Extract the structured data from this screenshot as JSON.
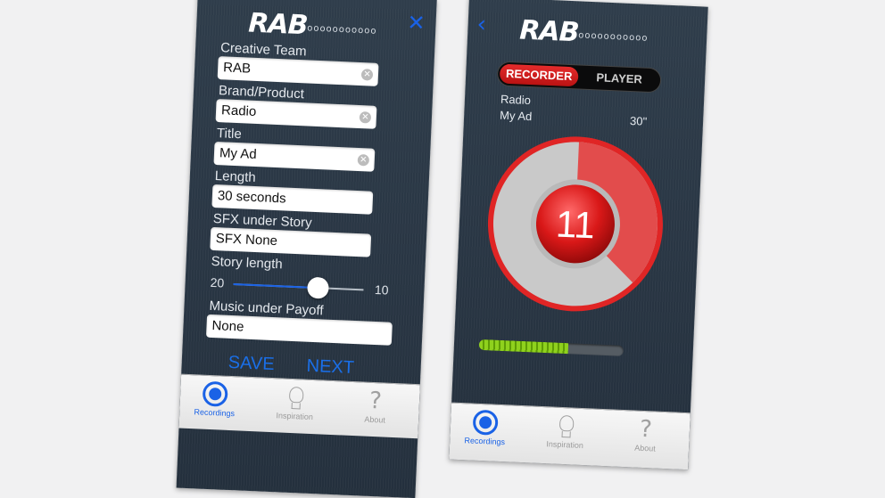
{
  "form_screen": {
    "logo": "RAB",
    "logo_dots": "ooooooooooo",
    "close_glyph": "✕",
    "fields": [
      {
        "label": "Creative Team",
        "value": "RAB",
        "clearable": true
      },
      {
        "label": "Brand/Product",
        "value": "Radio",
        "clearable": true
      },
      {
        "label": "Title",
        "value": "My Ad",
        "clearable": true
      },
      {
        "label": "Length",
        "value": "30 seconds",
        "clearable": false
      },
      {
        "label": "SFX under Story",
        "value": "SFX None",
        "clearable": false
      }
    ],
    "story_length": {
      "label": "Story length",
      "min_label": "20",
      "max_label": "10",
      "level": 0.65
    },
    "music": {
      "label": "Music under Payoff",
      "value": "None"
    },
    "save_label": "SAVE",
    "next_label": "NEXT"
  },
  "recorder_screen": {
    "logo": "RAB",
    "logo_dots": "ooooooooooo",
    "back_glyph": "‹",
    "segment": {
      "recorder": "RECORDER",
      "player": "PLAYER",
      "selected": "RECORDER"
    },
    "brand": "Radio",
    "title": "My Ad",
    "duration": "30\"",
    "countdown": "11",
    "dial_elapsed_fraction": 0.37,
    "progress_fraction": 0.62,
    "colors": {
      "accent": "#e52c2c",
      "progress": "#8fd11d"
    }
  },
  "tabbar": {
    "recordings": "Recordings",
    "inspiration": "Inspiration",
    "about": "About"
  },
  "icons": {
    "question": "?"
  }
}
